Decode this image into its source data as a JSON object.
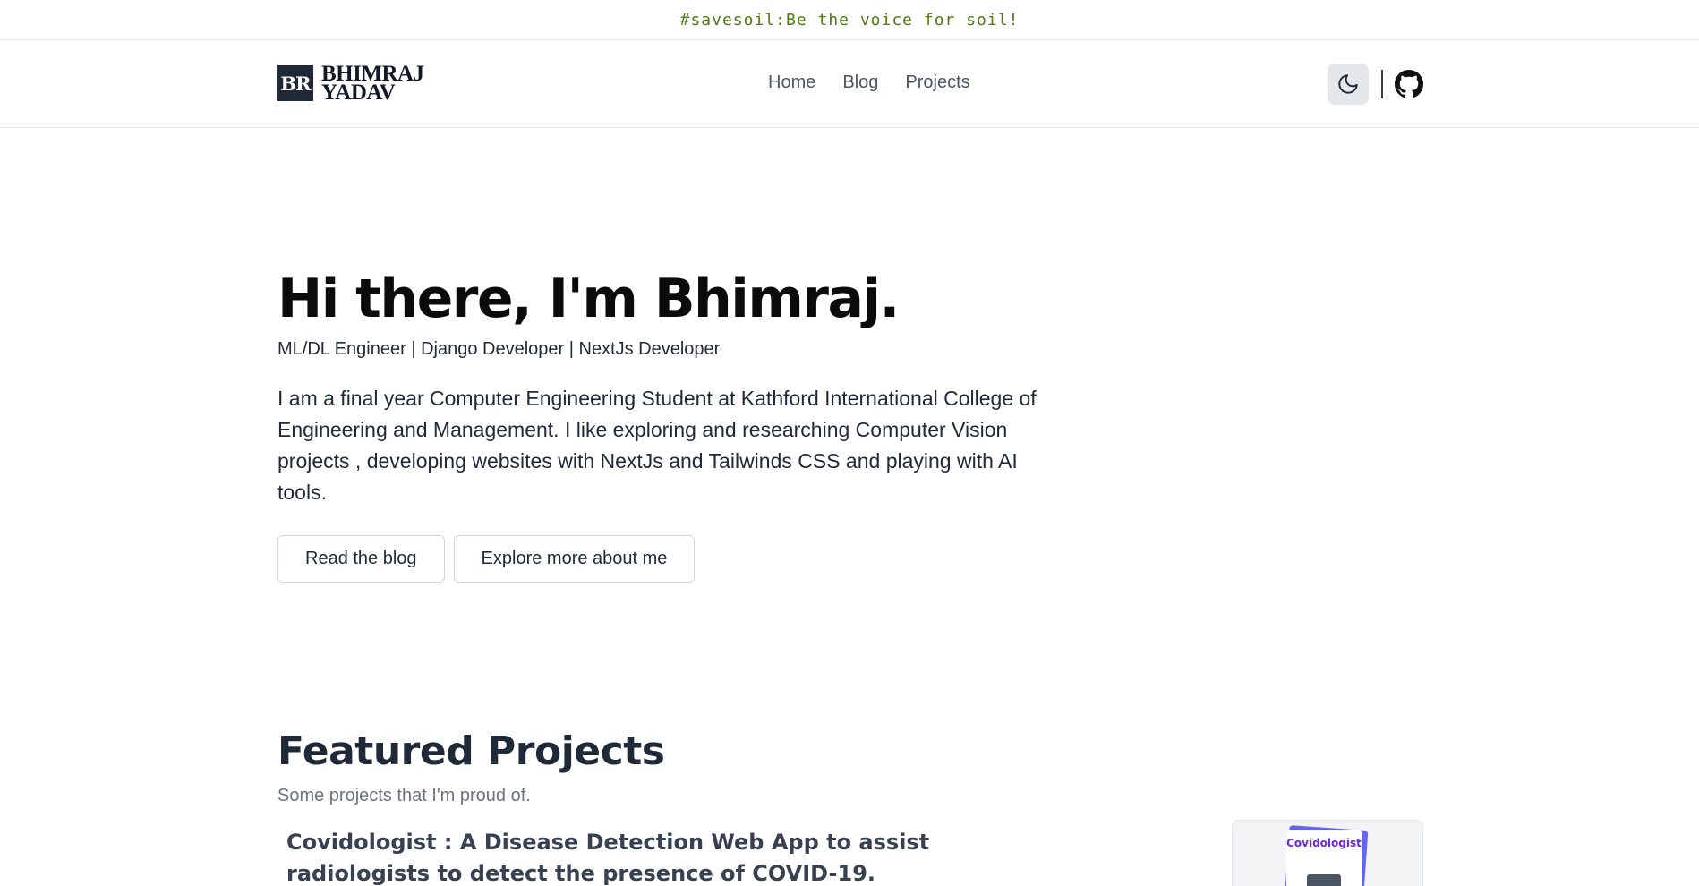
{
  "banner": {
    "text": "#savesoil:Be the voice for soil!"
  },
  "header": {
    "logo_mark": "BR",
    "logo_line1": "BHIMRAJ",
    "logo_line2": "YADAV",
    "nav": [
      "Home",
      "Blog",
      "Projects"
    ],
    "icons": {
      "theme": "moon-icon",
      "github": "github-icon"
    }
  },
  "hero": {
    "heading": "Hi there, I'm Bhimraj.",
    "subtitle": "ML/DL Engineer | Django Developer | NextJs Developer",
    "intro": "I am a final year Computer Engineering Student at Kathford International College of Engineering and Management. I like exploring and researching Computer Vision projects , developing websites with NextJs and Tailwinds CSS and playing with AI tools.",
    "buttons": [
      "Read the blog",
      "Explore more about me"
    ]
  },
  "featured": {
    "heading": "Featured Projects",
    "subtitle": "Some projects that I'm proud of.",
    "project": {
      "title": "Covidologist : A Disease Detection Web App to assist radiologists to detect the presence of COVID-19.",
      "thumb_title": "Covidologist"
    }
  },
  "colors": {
    "banner_text": "#4d7c0f",
    "accent_dark": "#1f2937",
    "thumb_accent": "#6366f1"
  }
}
